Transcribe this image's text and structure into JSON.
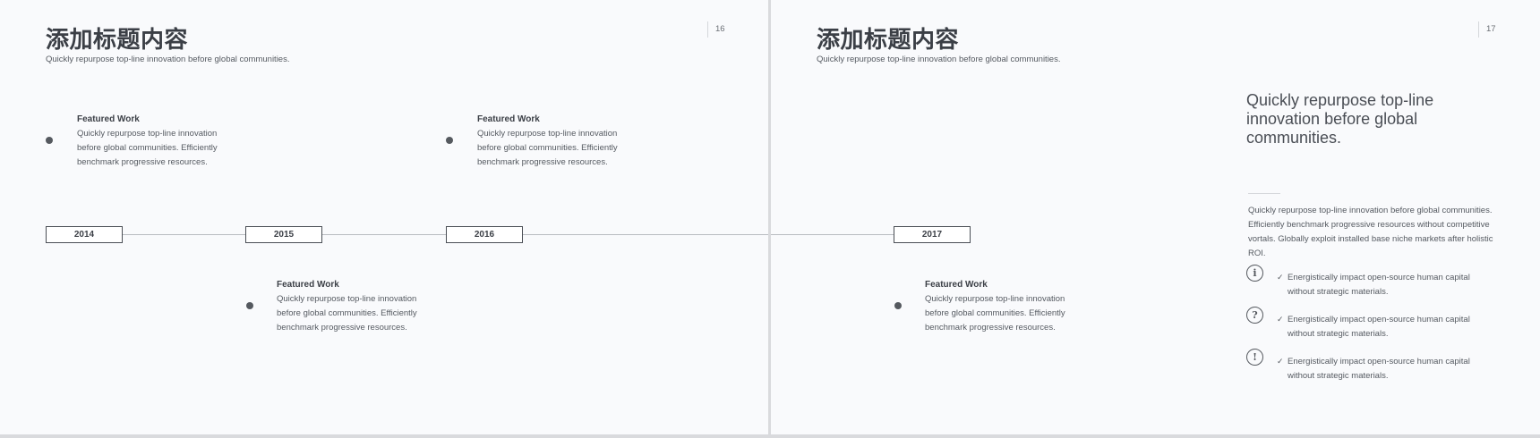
{
  "slides": [
    {
      "title": "添加标题内容",
      "subtitle": "Quickly repurpose top-line innovation before global communities.",
      "page_number": "16",
      "years": [
        "2014",
        "2015",
        "2016"
      ],
      "items": [
        {
          "title": "Featured Work",
          "desc": "Quickly repurpose top-line innovation before global communities. Efficiently benchmark progressive resources."
        },
        {
          "title": "Featured Work",
          "desc": "Quickly repurpose top-line innovation before global communities. Efficiently benchmark progressive resources."
        },
        {
          "title": "Featured Work",
          "desc": "Quickly repurpose top-line innovation before global communities. Efficiently benchmark progressive resources."
        }
      ]
    },
    {
      "title": "添加标题内容",
      "subtitle": "Quickly repurpose top-line innovation before global communities.",
      "page_number": "17",
      "years": [
        "2017"
      ],
      "items": [
        {
          "title": "Featured Work",
          "desc": "Quickly repurpose top-line innovation before global communities. Efficiently benchmark progressive resources."
        }
      ],
      "headline": "Quickly repurpose top-line innovation before global communities.",
      "paragraph": "Quickly repurpose top-line innovation before global communities. Efficiently benchmark progressive resources without competitive vortals. Globally exploit installed base niche markets after holistic ROI.",
      "checklist": [
        {
          "icon": "info-icon",
          "symbol": "i",
          "check": "✓",
          "text": "Energistically impact open-source human capital without strategic materials."
        },
        {
          "icon": "question-icon",
          "symbol": "?",
          "check": "✓",
          "text": "Energistically impact open-source human capital without strategic materials."
        },
        {
          "icon": "exclamation-icon",
          "symbol": "!",
          "check": "✓",
          "text": "Energistically impact open-source human capital without strategic materials."
        }
      ]
    }
  ],
  "colors": {
    "background": "#f9fafc",
    "text_dark": "#3b3f46",
    "text_body": "#555a61",
    "line": "#b9bcc1"
  }
}
